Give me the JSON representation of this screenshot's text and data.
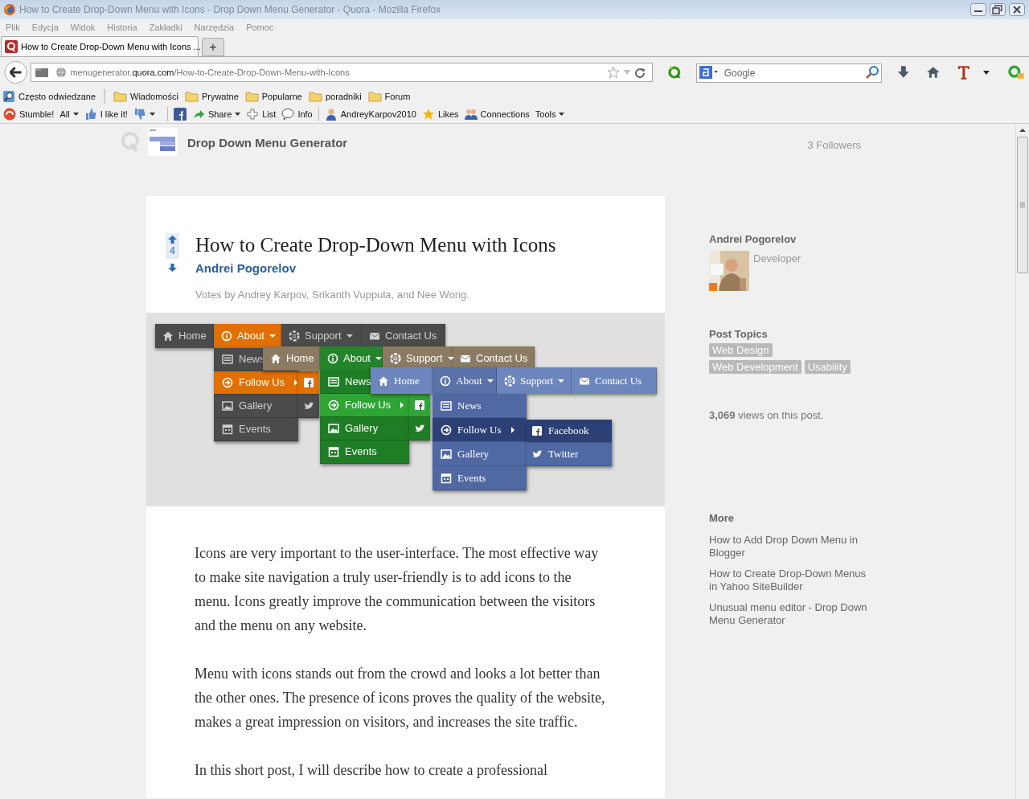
{
  "window": {
    "title": "How to Create Drop-Down Menu with Icons - Drop Down Menu Generator - Quora - Mozilla Firefox"
  },
  "menu_bar": [
    "Plik",
    "Edycja",
    "Widok",
    "Historia",
    "Zakładki",
    "Narzędzia",
    "Pomoc"
  ],
  "tabs": [
    {
      "label": "How to Create Drop-Down Menu with Icons ...",
      "selected": true
    }
  ],
  "new_tab": "+",
  "address": {
    "prefix": "menugenerator.",
    "host": "quora.com",
    "path": "/How-to-Create-Drop-Down-Menu-with-Icons"
  },
  "search": {
    "placeholder": "Google"
  },
  "bookmarks": [
    {
      "label": "Często odwiedzane",
      "kind": "smart"
    },
    {
      "label": "Wiadomości",
      "kind": "folder"
    },
    {
      "label": "Prywatne",
      "kind": "folder"
    },
    {
      "label": "Popularne",
      "kind": "folder"
    },
    {
      "label": "poradniki",
      "kind": "folder"
    },
    {
      "label": "Forum",
      "kind": "folder"
    }
  ],
  "addon_bar": [
    {
      "label": "Stumble!",
      "kind": "stumble",
      "caret": false
    },
    {
      "label": "All",
      "kind": "text",
      "caret": true
    },
    {
      "label": "I like it!",
      "kind": "like",
      "caret": false
    },
    {
      "kind": "dislike",
      "caret": true
    },
    {
      "kind": "facebook",
      "caret": false
    },
    {
      "label": "Share",
      "kind": "share",
      "caret": true
    },
    {
      "label": "List",
      "kind": "list",
      "caret": false
    },
    {
      "label": "Info",
      "kind": "info",
      "caret": false
    },
    {
      "label": "AndreyKarpov2010",
      "kind": "user",
      "caret": false
    },
    {
      "label": "Likes",
      "kind": "star",
      "caret": false
    },
    {
      "label": "Connections",
      "kind": "people",
      "caret": false
    },
    {
      "label": "Tools",
      "kind": "text",
      "caret": true
    }
  ],
  "header": {
    "site": "Drop Down Menu Generator",
    "followers": "3 Followers"
  },
  "article": {
    "votes": "4",
    "title": "How to Create Drop-Down Menu with Icons",
    "author": "Andrei Pogorelov",
    "votes_by": "Votes by Andrey Karpov, Srikanth Vuppula, and Nee Wong.",
    "figure": {
      "menus": [
        {
          "kind": "dark-orange",
          "items": [
            {
              "label": "Home",
              "selected": false,
              "caret": false
            },
            {
              "label": "About",
              "selected": true,
              "caret": true
            },
            {
              "label": "Support",
              "selected": false,
              "caret": true
            },
            {
              "label": "Contact Us",
              "selected": false,
              "caret": false
            }
          ],
          "dropdown": [
            {
              "label": "News",
              "selected": false,
              "caret": false
            },
            {
              "label": "Follow Us",
              "selected": true,
              "caret": true
            },
            {
              "label": "Gallery",
              "selected": false,
              "caret": false
            },
            {
              "label": "Events",
              "selected": false,
              "caret": false
            }
          ],
          "submenu": [
            {
              "selected": true
            },
            {
              "selected": false
            }
          ]
        },
        {
          "kind": "brown-green",
          "items": [
            {
              "label": "Home",
              "selected": false,
              "caret": false
            },
            {
              "label": "About",
              "selected": true,
              "caret": true
            },
            {
              "label": "Support",
              "selected": false,
              "caret": true
            },
            {
              "label": "Contact Us",
              "selected": false,
              "caret": false
            }
          ],
          "dropdown": [
            {
              "label": "News",
              "selected": false,
              "caret": false
            },
            {
              "label": "Follow Us",
              "selected": true,
              "caret": true
            },
            {
              "label": "Gallery",
              "selected": false,
              "caret": false
            },
            {
              "label": "Events",
              "selected": false,
              "caret": false
            }
          ],
          "submenu": [
            {
              "selected": true
            },
            {
              "selected": false
            }
          ]
        },
        {
          "kind": "blue",
          "items": [
            {
              "label": "Home",
              "selected": false,
              "caret": false
            },
            {
              "label": "About",
              "selected": true,
              "caret": true
            },
            {
              "label": "Support",
              "selected": false,
              "caret": true
            },
            {
              "label": "Contact Us",
              "selected": false,
              "caret": false
            }
          ],
          "dropdown": [
            {
              "label": "News",
              "selected": false,
              "caret": false
            },
            {
              "label": "Follow Us",
              "selected": true,
              "caret": true
            },
            {
              "label": "Gallery",
              "selected": false,
              "caret": false
            },
            {
              "label": "Events",
              "selected": false,
              "caret": false
            }
          ],
          "submenu": [
            {
              "label": "Facebook",
              "selected": true
            },
            {
              "label": "Twitter",
              "selected": false
            }
          ]
        }
      ]
    },
    "paragraphs": [
      "Icons are very important to the user-interface. The most effective way to make site navigation a truly user-friendly is to add icons to the menu. Icons greatly improve the communication between the visitors and the menu on any website.",
      "Menu with icons stands out from the crowd and looks a lot better than the other ones. The presence of icons proves the quality of the website, makes a great impression on visitors, and increases the site traffic.",
      "In this short post, I will describe how to create a professional"
    ]
  },
  "sidebar": {
    "author": {
      "name": "Andrei Pogorelov",
      "role": "Developer"
    },
    "topics_title": "Post Topics",
    "topics": [
      "Web Design",
      "Web Development",
      "Usability"
    ],
    "views": "**3,069** views on this post.",
    "more_title": "More",
    "more_links": [
      "How to Add Drop Down Menu in Blogger",
      "How to Create Drop-Down Menus in Yahoo SiteBuilder",
      "Unusual menu editor - Drop Down Menu Generator"
    ]
  }
}
